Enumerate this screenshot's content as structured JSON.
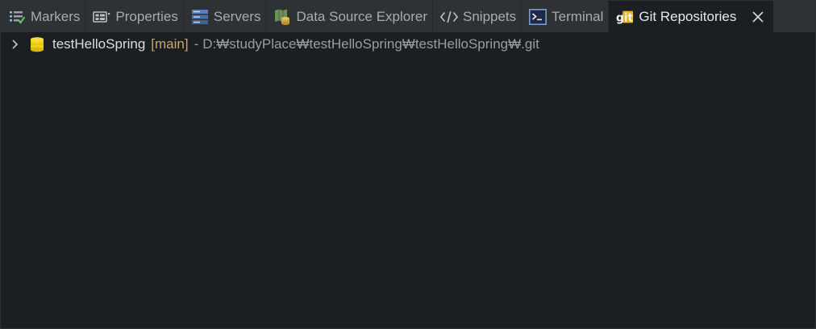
{
  "tabs": [
    {
      "label": "Markers",
      "icon": "markers-icon"
    },
    {
      "label": "Properties",
      "icon": "properties-icon"
    },
    {
      "label": "Servers",
      "icon": "servers-icon"
    },
    {
      "label": "Data Source Explorer",
      "icon": "data-source-explorer-icon"
    },
    {
      "label": "Snippets",
      "icon": "snippets-icon"
    },
    {
      "label": "Terminal",
      "icon": "terminal-icon"
    },
    {
      "label": "Git Repositories",
      "icon": "git-icon",
      "active": true
    }
  ],
  "repositories": [
    {
      "name": "testHelloSpring",
      "branch": "[main]",
      "separator": "-",
      "path": "D:₩studyPlace₩testHelloSpring₩testHelloSpring₩.git"
    }
  ],
  "colors": {
    "branch": "#c9a66b",
    "background": "#1c1f21",
    "tabbar": "#2f3234"
  }
}
